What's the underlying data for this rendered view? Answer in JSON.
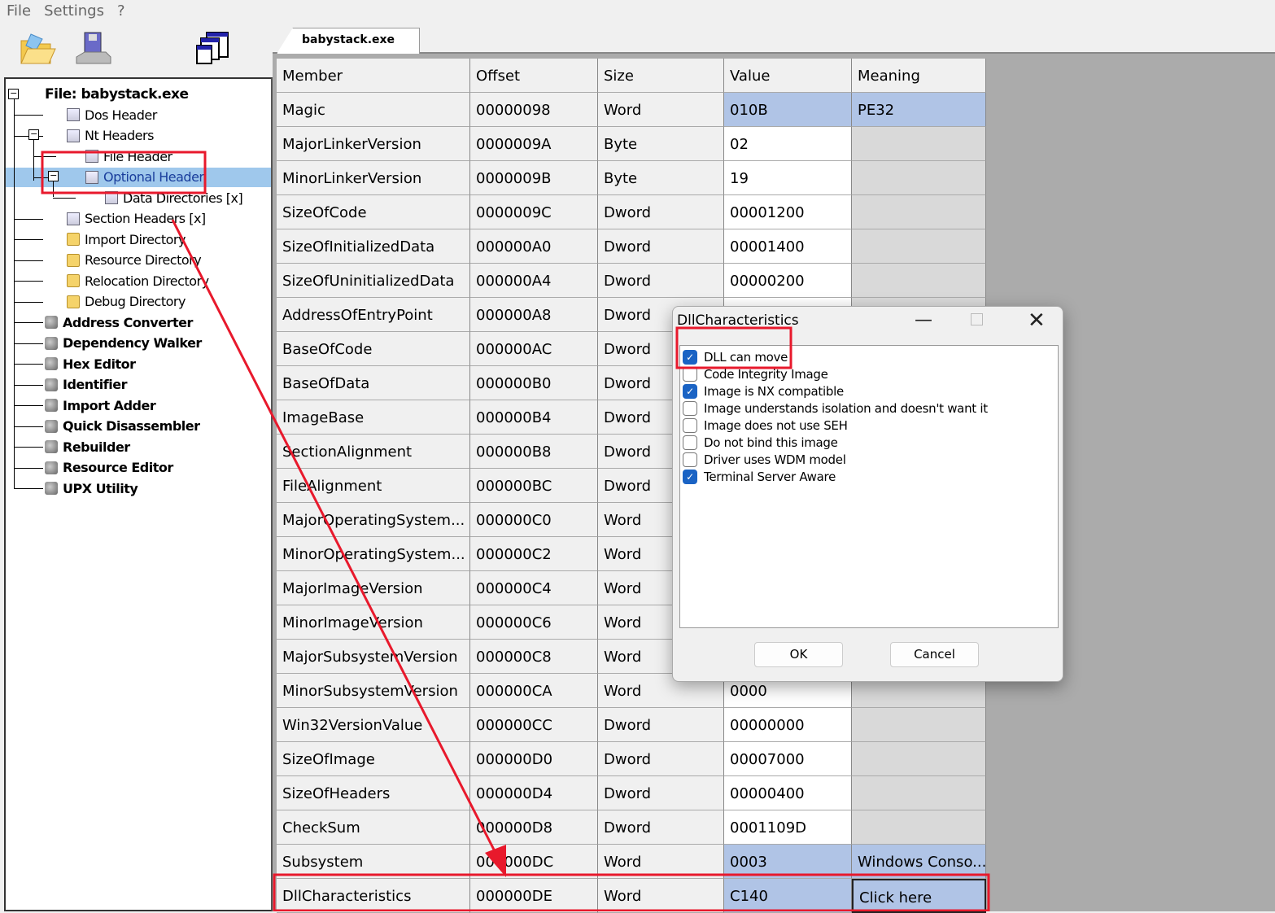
{
  "menu": [
    "File",
    "Settings",
    "?"
  ],
  "toolbar": [
    {
      "icon": "open-folder-icon"
    },
    {
      "icon": "save-disk-icon"
    },
    {
      "icon": "windows-icon"
    }
  ],
  "tree": {
    "root": "File: babystack.exe",
    "items": [
      {
        "label": "Dos Header",
        "icon": "doc"
      },
      {
        "label": "Nt Headers",
        "icon": "doc"
      },
      {
        "label": "File Header",
        "icon": "doc"
      },
      {
        "label": "Optional Header",
        "icon": "doc",
        "selected": true
      },
      {
        "label": "Data Directories [x]",
        "icon": "doc"
      },
      {
        "label": "Section Headers [x]",
        "icon": "doc"
      },
      {
        "label": "Import Directory",
        "icon": "folder"
      },
      {
        "label": "Resource Directory",
        "icon": "folder"
      },
      {
        "label": "Relocation Directory",
        "icon": "folder"
      },
      {
        "label": "Debug Directory",
        "icon": "folder"
      },
      {
        "label": "Address Converter",
        "icon": "tool"
      },
      {
        "label": "Dependency Walker",
        "icon": "tool"
      },
      {
        "label": "Hex Editor",
        "icon": "tool"
      },
      {
        "label": "Identifier",
        "icon": "tool"
      },
      {
        "label": "Import Adder",
        "icon": "tool"
      },
      {
        "label": "Quick Disassembler",
        "icon": "tool"
      },
      {
        "label": "Rebuilder",
        "icon": "tool"
      },
      {
        "label": "Resource Editor",
        "icon": "tool"
      },
      {
        "label": "UPX Utility",
        "icon": "tool"
      }
    ]
  },
  "tab": "babystack.exe",
  "grid": {
    "headers": [
      "Member",
      "Offset",
      "Size",
      "Value",
      "Meaning"
    ],
    "rows": [
      [
        "Magic",
        "00000098",
        "Word",
        "010B",
        "PE32"
      ],
      [
        "MajorLinkerVersion",
        "0000009A",
        "Byte",
        "02",
        ""
      ],
      [
        "MinorLinkerVersion",
        "0000009B",
        "Byte",
        "19",
        ""
      ],
      [
        "SizeOfCode",
        "0000009C",
        "Dword",
        "00001200",
        ""
      ],
      [
        "SizeOfInitializedData",
        "000000A0",
        "Dword",
        "00001400",
        ""
      ],
      [
        "SizeOfUninitializedData",
        "000000A4",
        "Dword",
        "00000200",
        ""
      ],
      [
        "AddressOfEntryPoint",
        "000000A8",
        "Dword",
        "",
        ""
      ],
      [
        "BaseOfCode",
        "000000AC",
        "Dword",
        "",
        ""
      ],
      [
        "BaseOfData",
        "000000B0",
        "Dword",
        "",
        ""
      ],
      [
        "ImageBase",
        "000000B4",
        "Dword",
        "",
        ""
      ],
      [
        "SectionAlignment",
        "000000B8",
        "Dword",
        "",
        ""
      ],
      [
        "FileAlignment",
        "000000BC",
        "Dword",
        "",
        ""
      ],
      [
        "MajorOperatingSystem...",
        "000000C0",
        "Word",
        "",
        ""
      ],
      [
        "MinorOperatingSystem...",
        "000000C2",
        "Word",
        "",
        ""
      ],
      [
        "MajorImageVersion",
        "000000C4",
        "Word",
        "",
        ""
      ],
      [
        "MinorImageVersion",
        "000000C6",
        "Word",
        "",
        ""
      ],
      [
        "MajorSubsystemVersion",
        "000000C8",
        "Word",
        "",
        ""
      ],
      [
        "MinorSubsystemVersion",
        "000000CA",
        "Word",
        "0000",
        ""
      ],
      [
        "Win32VersionValue",
        "000000CC",
        "Dword",
        "00000000",
        ""
      ],
      [
        "SizeOfImage",
        "000000D0",
        "Dword",
        "00007000",
        ""
      ],
      [
        "SizeOfHeaders",
        "000000D4",
        "Dword",
        "00000400",
        ""
      ],
      [
        "CheckSum",
        "000000D8",
        "Dword",
        "0001109D",
        ""
      ],
      [
        "Subsystem",
        "000000DC",
        "Word",
        "0003",
        "Windows Conso..."
      ],
      [
        "DllCharacteristics",
        "000000DE",
        "Word",
        "C140",
        "Click here"
      ]
    ]
  },
  "dialog": {
    "title": "DllCharacteristics",
    "options": [
      {
        "label": "DLL can move",
        "checked": true
      },
      {
        "label": "Code Integrity Image",
        "checked": false
      },
      {
        "label": "Image is NX compatible",
        "checked": true
      },
      {
        "label": "Image understands isolation and doesn't want it",
        "checked": false
      },
      {
        "label": "Image does not use SEH",
        "checked": false
      },
      {
        "label": "Do not bind this image",
        "checked": false
      },
      {
        "label": "Driver uses WDM model",
        "checked": false
      },
      {
        "label": "Terminal Server Aware",
        "checked": true
      }
    ],
    "ok": "OK",
    "cancel": "Cancel"
  },
  "colors": {
    "selection": "#9fc8ec",
    "highlight": "#b0c4e6",
    "annotation": "#e8192c",
    "checkbox": "#1a63c4"
  }
}
